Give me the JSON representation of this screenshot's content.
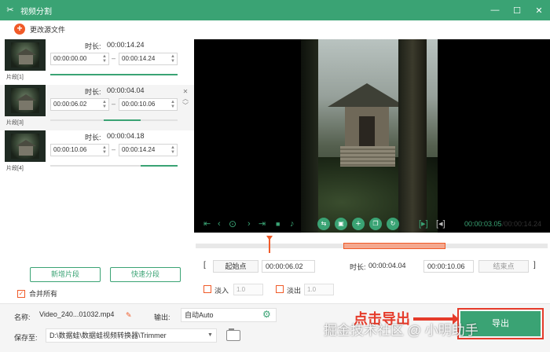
{
  "window": {
    "title": "视频分割",
    "controls": [
      "minimize",
      "maximize",
      "close"
    ]
  },
  "left_panel": {
    "add_source_label": "更改源文件",
    "duration_label": "时长:",
    "clips": [
      {
        "label": "片段[1]",
        "duration": "00:00:14.24",
        "start": "00:00:00.00",
        "end": "00:00:14.24",
        "progress_start": 0.0,
        "progress_end": 1.0
      },
      {
        "label": "片段[3]",
        "duration": "00:00:04.04",
        "start": "00:00:06.02",
        "end": "00:00:10.06",
        "progress_start": 0.42,
        "progress_end": 0.71
      },
      {
        "label": "片段[4]",
        "duration": "00:00:04.18",
        "start": "00:00:10.06",
        "end": "00:00:14.24",
        "progress_start": 0.71,
        "progress_end": 1.0
      }
    ],
    "new_segment_button": "新增片段",
    "quick_split_button": "快速分段",
    "merge_all_label": "合并所有",
    "merge_all_checked": true
  },
  "player": {
    "current_time": "00:00:03.05",
    "total_time": "/00:00:14.24",
    "playhead_fraction": 0.21,
    "selection_start_fraction": 0.42,
    "selection_end_fraction": 0.71
  },
  "segment": {
    "start_button": "起始点",
    "start_value": "00:00:06.02",
    "duration_label": "时长:",
    "duration_value": "00:00:04.04",
    "end_value": "00:00:10.06",
    "end_button": "结束点"
  },
  "fade": {
    "fade_in_label": "淡入",
    "fade_in_value": "1.0",
    "fade_out_label": "淡出",
    "fade_out_value": "1.0"
  },
  "bottom": {
    "name_label": "名称:",
    "name_value": "Video_240...01032.mp4",
    "output_label": "输出:",
    "output_value": "自动Auto",
    "save_label": "保存至:",
    "save_value": "D:\\数据蛙\\数据蛙视频转换器\\Trimmer",
    "export_button": "导出",
    "annotation": "点击导出"
  },
  "watermark": "掘金技术社区 @ 小明助手",
  "colors": {
    "accent": "#3aa374",
    "highlight": "#f05a28",
    "annotation": "#e53b2a"
  }
}
